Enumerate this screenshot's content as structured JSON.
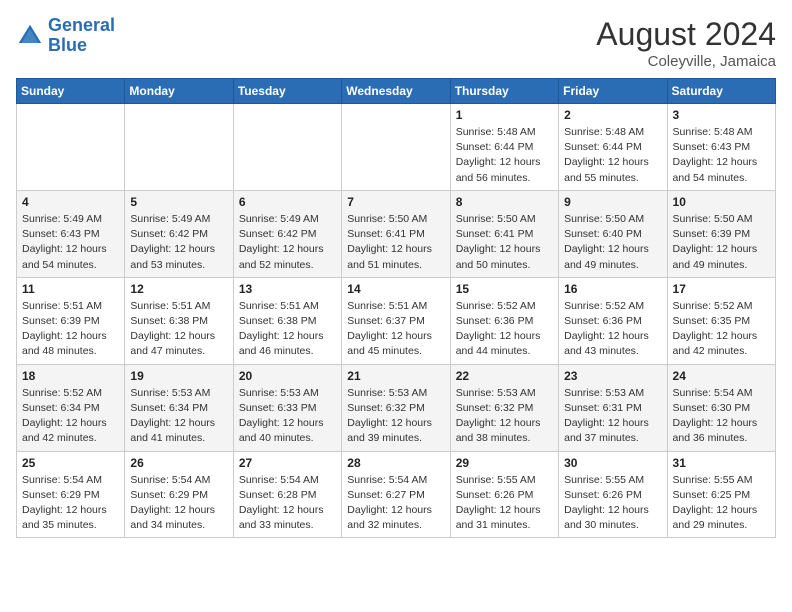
{
  "header": {
    "logo_line1": "General",
    "logo_line2": "Blue",
    "month": "August 2024",
    "location": "Coleyville, Jamaica"
  },
  "weekdays": [
    "Sunday",
    "Monday",
    "Tuesday",
    "Wednesday",
    "Thursday",
    "Friday",
    "Saturday"
  ],
  "weeks": [
    [
      {
        "day": "",
        "info": ""
      },
      {
        "day": "",
        "info": ""
      },
      {
        "day": "",
        "info": ""
      },
      {
        "day": "",
        "info": ""
      },
      {
        "day": "1",
        "info": "Sunrise: 5:48 AM\nSunset: 6:44 PM\nDaylight: 12 hours\nand 56 minutes."
      },
      {
        "day": "2",
        "info": "Sunrise: 5:48 AM\nSunset: 6:44 PM\nDaylight: 12 hours\nand 55 minutes."
      },
      {
        "day": "3",
        "info": "Sunrise: 5:48 AM\nSunset: 6:43 PM\nDaylight: 12 hours\nand 54 minutes."
      }
    ],
    [
      {
        "day": "4",
        "info": "Sunrise: 5:49 AM\nSunset: 6:43 PM\nDaylight: 12 hours\nand 54 minutes."
      },
      {
        "day": "5",
        "info": "Sunrise: 5:49 AM\nSunset: 6:42 PM\nDaylight: 12 hours\nand 53 minutes."
      },
      {
        "day": "6",
        "info": "Sunrise: 5:49 AM\nSunset: 6:42 PM\nDaylight: 12 hours\nand 52 minutes."
      },
      {
        "day": "7",
        "info": "Sunrise: 5:50 AM\nSunset: 6:41 PM\nDaylight: 12 hours\nand 51 minutes."
      },
      {
        "day": "8",
        "info": "Sunrise: 5:50 AM\nSunset: 6:41 PM\nDaylight: 12 hours\nand 50 minutes."
      },
      {
        "day": "9",
        "info": "Sunrise: 5:50 AM\nSunset: 6:40 PM\nDaylight: 12 hours\nand 49 minutes."
      },
      {
        "day": "10",
        "info": "Sunrise: 5:50 AM\nSunset: 6:39 PM\nDaylight: 12 hours\nand 49 minutes."
      }
    ],
    [
      {
        "day": "11",
        "info": "Sunrise: 5:51 AM\nSunset: 6:39 PM\nDaylight: 12 hours\nand 48 minutes."
      },
      {
        "day": "12",
        "info": "Sunrise: 5:51 AM\nSunset: 6:38 PM\nDaylight: 12 hours\nand 47 minutes."
      },
      {
        "day": "13",
        "info": "Sunrise: 5:51 AM\nSunset: 6:38 PM\nDaylight: 12 hours\nand 46 minutes."
      },
      {
        "day": "14",
        "info": "Sunrise: 5:51 AM\nSunset: 6:37 PM\nDaylight: 12 hours\nand 45 minutes."
      },
      {
        "day": "15",
        "info": "Sunrise: 5:52 AM\nSunset: 6:36 PM\nDaylight: 12 hours\nand 44 minutes."
      },
      {
        "day": "16",
        "info": "Sunrise: 5:52 AM\nSunset: 6:36 PM\nDaylight: 12 hours\nand 43 minutes."
      },
      {
        "day": "17",
        "info": "Sunrise: 5:52 AM\nSunset: 6:35 PM\nDaylight: 12 hours\nand 42 minutes."
      }
    ],
    [
      {
        "day": "18",
        "info": "Sunrise: 5:52 AM\nSunset: 6:34 PM\nDaylight: 12 hours\nand 42 minutes."
      },
      {
        "day": "19",
        "info": "Sunrise: 5:53 AM\nSunset: 6:34 PM\nDaylight: 12 hours\nand 41 minutes."
      },
      {
        "day": "20",
        "info": "Sunrise: 5:53 AM\nSunset: 6:33 PM\nDaylight: 12 hours\nand 40 minutes."
      },
      {
        "day": "21",
        "info": "Sunrise: 5:53 AM\nSunset: 6:32 PM\nDaylight: 12 hours\nand 39 minutes."
      },
      {
        "day": "22",
        "info": "Sunrise: 5:53 AM\nSunset: 6:32 PM\nDaylight: 12 hours\nand 38 minutes."
      },
      {
        "day": "23",
        "info": "Sunrise: 5:53 AM\nSunset: 6:31 PM\nDaylight: 12 hours\nand 37 minutes."
      },
      {
        "day": "24",
        "info": "Sunrise: 5:54 AM\nSunset: 6:30 PM\nDaylight: 12 hours\nand 36 minutes."
      }
    ],
    [
      {
        "day": "25",
        "info": "Sunrise: 5:54 AM\nSunset: 6:29 PM\nDaylight: 12 hours\nand 35 minutes."
      },
      {
        "day": "26",
        "info": "Sunrise: 5:54 AM\nSunset: 6:29 PM\nDaylight: 12 hours\nand 34 minutes."
      },
      {
        "day": "27",
        "info": "Sunrise: 5:54 AM\nSunset: 6:28 PM\nDaylight: 12 hours\nand 33 minutes."
      },
      {
        "day": "28",
        "info": "Sunrise: 5:54 AM\nSunset: 6:27 PM\nDaylight: 12 hours\nand 32 minutes."
      },
      {
        "day": "29",
        "info": "Sunrise: 5:55 AM\nSunset: 6:26 PM\nDaylight: 12 hours\nand 31 minutes."
      },
      {
        "day": "30",
        "info": "Sunrise: 5:55 AM\nSunset: 6:26 PM\nDaylight: 12 hours\nand 30 minutes."
      },
      {
        "day": "31",
        "info": "Sunrise: 5:55 AM\nSunset: 6:25 PM\nDaylight: 12 hours\nand 29 minutes."
      }
    ]
  ]
}
